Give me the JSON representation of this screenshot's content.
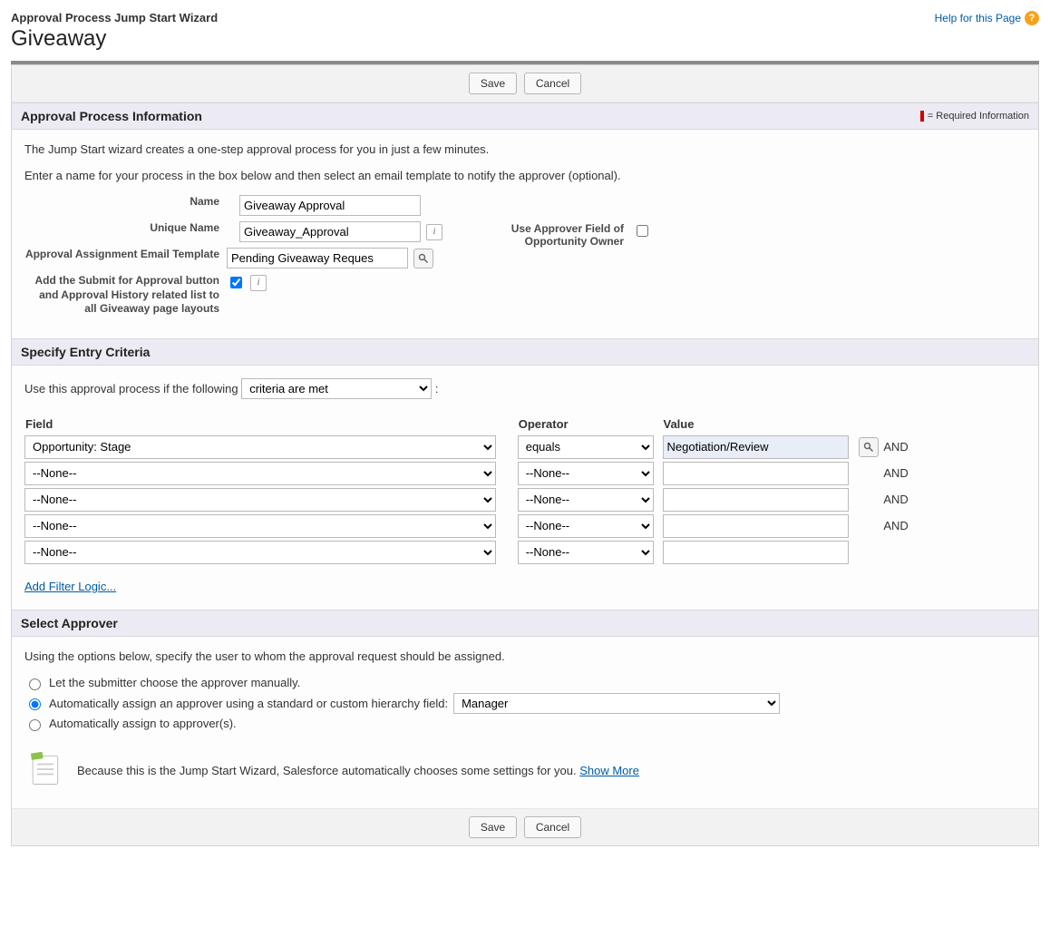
{
  "header": {
    "subtitle": "Approval Process Jump Start Wizard",
    "title": "Giveaway",
    "help_text": "Help for this Page"
  },
  "buttons": {
    "save": "Save",
    "cancel": "Cancel"
  },
  "required_info_label": "= Required Information",
  "section1": {
    "title": "Approval Process Information",
    "desc1": "The Jump Start wizard creates a one-step approval process for you in just a few minutes.",
    "desc2": "Enter a name for your process in the box below and then select an email template to notify the approver (optional).",
    "labels": {
      "name": "Name",
      "unique_name": "Unique Name",
      "template": "Approval Assignment Email Template",
      "add_submit": "Add the Submit for Approval button and Approval History related list to all Giveaway page layouts",
      "use_approver": "Use Approver Field of Opportunity Owner"
    },
    "values": {
      "name": "Giveaway Approval",
      "unique_name": "Giveaway_Approval",
      "template": "Pending Giveaway Reques",
      "add_submit_checked": true,
      "use_approver_checked": false
    }
  },
  "section2": {
    "title": "Specify Entry Criteria",
    "lead": "Use this approval process if the following",
    "mode_selected": "criteria are met",
    "colon": ":",
    "headers": {
      "field": "Field",
      "operator": "Operator",
      "value": "Value"
    },
    "none_option": "--None--",
    "rows": [
      {
        "field": "Opportunity: Stage",
        "operator": "equals",
        "value": "Negotiation/Review",
        "and": "AND",
        "lookup": true,
        "highlight": true
      },
      {
        "field": "--None--",
        "operator": "--None--",
        "value": "",
        "and": "AND"
      },
      {
        "field": "--None--",
        "operator": "--None--",
        "value": "",
        "and": "AND"
      },
      {
        "field": "--None--",
        "operator": "--None--",
        "value": "",
        "and": "AND"
      },
      {
        "field": "--None--",
        "operator": "--None--",
        "value": "",
        "and": ""
      }
    ],
    "add_filter": "Add Filter Logic..."
  },
  "section3": {
    "title": "Select Approver",
    "desc": "Using the options below, specify the user to whom the approval request should be assigned.",
    "options": {
      "opt1": "Let the submitter choose the approver manually.",
      "opt2": "Automatically assign an approver using a standard or custom hierarchy field:",
      "opt3": "Automatically assign to approver(s)."
    },
    "selected": "opt2",
    "hierarchy_field": "Manager",
    "note_prefix": "Because this is the Jump Start Wizard, Salesforce automatically chooses some settings for you. ",
    "show_more": "Show More"
  }
}
